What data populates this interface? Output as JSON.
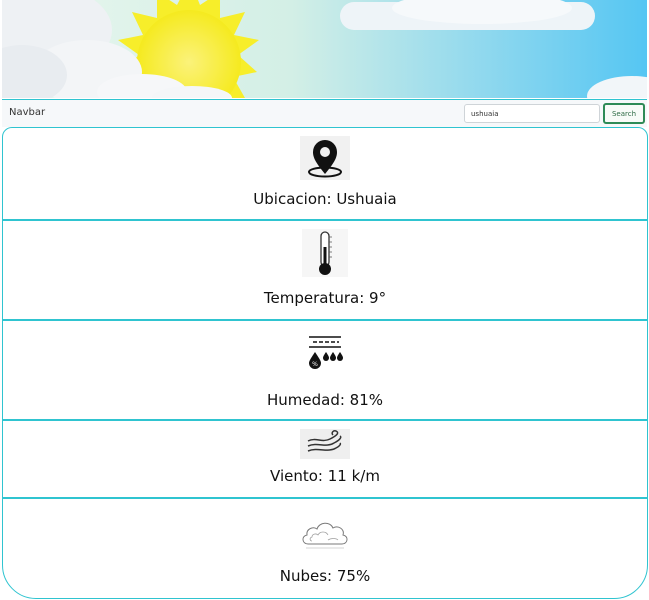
{
  "navbar": {
    "brand": "Navbar",
    "search_value": "ushuaia",
    "search_button": "Search"
  },
  "weather": {
    "location": "Ubicacion: Ushuaia",
    "temperature": "Temperatura: 9°",
    "humidity": "Humedad: 81%",
    "wind": "Viento: 11 k/m",
    "clouds": "Nubes: 75%",
    "humidity_icon_text": "%"
  },
  "icons": {
    "location": "map-pin-icon",
    "temperature": "thermometer-icon",
    "humidity": "humidity-drops-icon",
    "wind": "wind-icon",
    "clouds": "cloud-icon"
  },
  "colors": {
    "accent_border": "#2fc4d0",
    "search_button_border": "#2e8b57",
    "sky_left": "#dff3ea",
    "sky_right": "#5ec8f2",
    "sun": "#f7ee2a"
  }
}
